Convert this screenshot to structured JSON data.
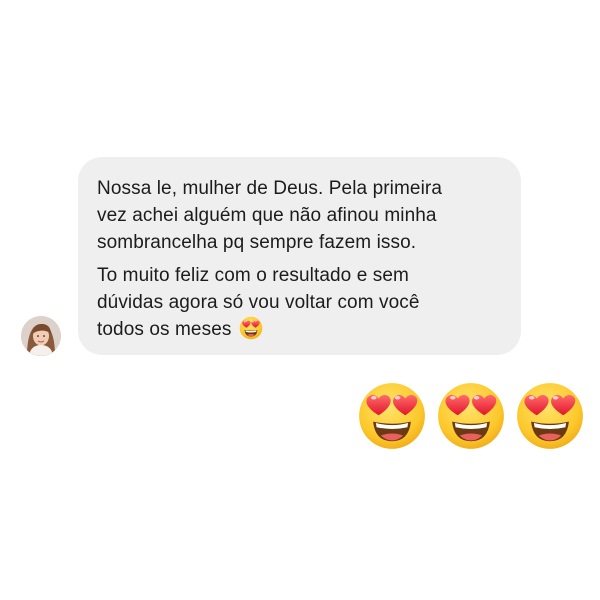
{
  "message": {
    "lines": [
      "Nossa le, mulher de Deus. Pela primeira",
      "vez achei alguém que não afinou minha",
      "sombrancelha pq sempre fazem isso.",
      "To muito feliz com o resultado e sem",
      "dúvidas agora só vou voltar com você",
      "todos os meses"
    ],
    "inline_emoji": "heart-eyes-emoji"
  },
  "reactions": [
    "heart-eyes-emoji",
    "heart-eyes-emoji",
    "heart-eyes-emoji"
  ],
  "colors": {
    "bubble": "#efefef",
    "text": "#1c1c1c",
    "emoji_face": "#ffcc33",
    "emoji_heart": "#f5323f"
  }
}
